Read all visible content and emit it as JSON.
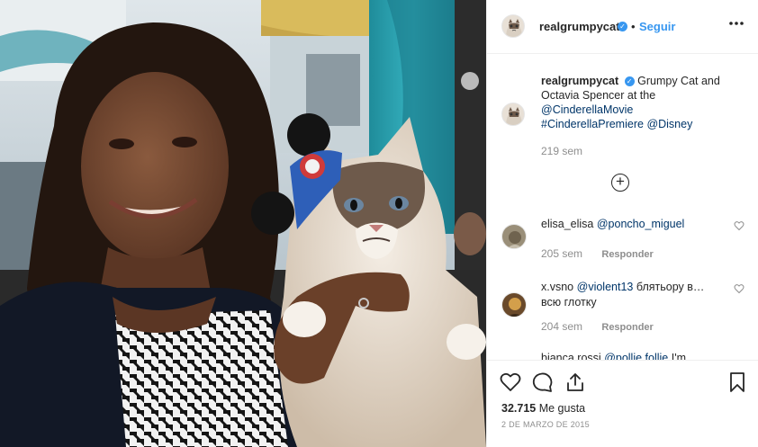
{
  "post": {
    "username": "realgrumpycat",
    "verified_glyph": "✓",
    "separator": "•",
    "follow_label": "Seguir",
    "more_label": "•••"
  },
  "caption": {
    "username": "realgrumpycat",
    "text": "Grumpy Cat and Octavia Spencer at the",
    "mention": "@CinderellaMovie",
    "hashtag": "#CinderellaPremiere",
    "tag2": "@Disney",
    "time": "219 sem"
  },
  "load_more": {
    "icon": "plus-circle-icon",
    "glyph": "+"
  },
  "comments": [
    {
      "username": "elisa_elisa",
      "mention": "@poncho_miguel",
      "text": "",
      "time": "205 sem",
      "reply": "Responder"
    },
    {
      "username": "x.vsno",
      "mention": "@violent13",
      "text": "блятьору в…",
      "text2": "всю глотку",
      "time": "204 sem",
      "reply": "Responder"
    }
  ],
  "partial_comment": {
    "username": "bianca.rossi",
    "mention": "@pollie.follie",
    "text": "I'm"
  },
  "actions": {
    "like_icon": "heart-icon",
    "comment_icon": "comment-icon",
    "share_icon": "share-icon",
    "save_icon": "bookmark-icon"
  },
  "likes": {
    "count": "32.715",
    "label": "Me gusta"
  },
  "date": "2 DE MARZO DE 2015",
  "colors": {
    "link": "#003569",
    "accent": "#3897f0",
    "muted": "#8e8e8e",
    "border": "#efefef"
  }
}
